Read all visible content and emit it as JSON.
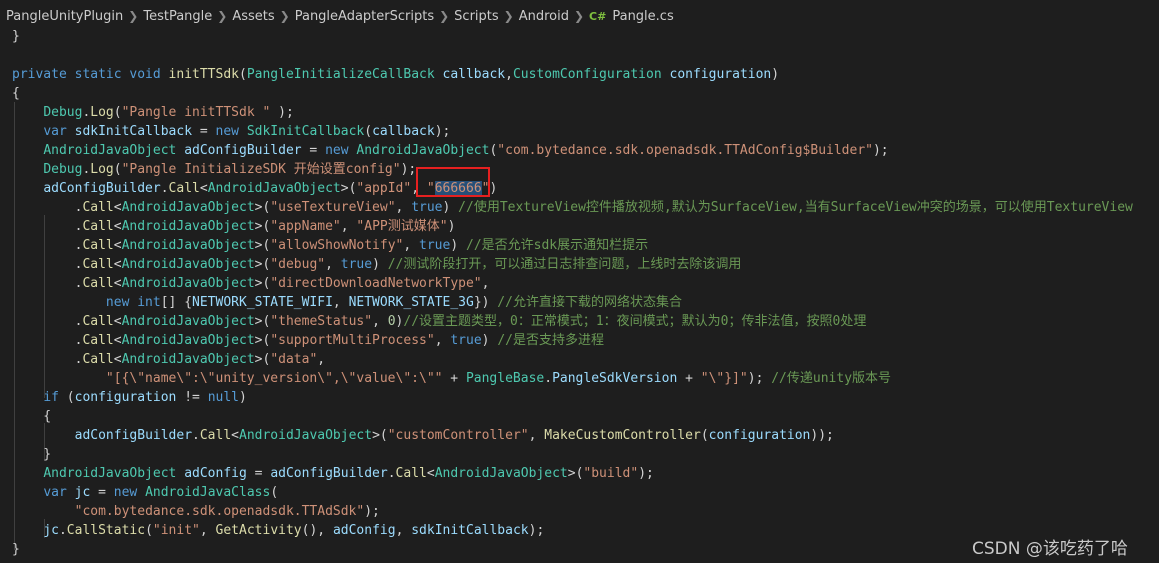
{
  "breadcrumb": {
    "items": [
      "PangleUnityPlugin",
      "TestPangle",
      "Assets",
      "PangleAdapterScripts",
      "Scripts",
      "Android"
    ],
    "file_lang_icon": "C#",
    "file_name": "Pangle.cs"
  },
  "code_lines": [
    [
      [
        "p",
        "}"
      ]
    ],
    [],
    [
      [
        "k",
        "private static void "
      ],
      [
        "f",
        "initTTSdk"
      ],
      [
        "p",
        "("
      ],
      [
        "t",
        "PangleInitializeCallBack"
      ],
      [
        "p",
        " "
      ],
      [
        "v",
        "callback"
      ],
      [
        "p",
        ","
      ],
      [
        "t",
        "CustomConfiguration"
      ],
      [
        "p",
        " "
      ],
      [
        "v",
        "configuration"
      ],
      [
        "p",
        ")"
      ]
    ],
    [
      [
        "p",
        "{"
      ]
    ],
    [
      [
        "p",
        "    "
      ],
      [
        "t",
        "Debug"
      ],
      [
        "p",
        "."
      ],
      [
        "f",
        "Log"
      ],
      [
        "p",
        "("
      ],
      [
        "s",
        "\"Pangle initTTSdk \""
      ],
      [
        "p",
        " );"
      ]
    ],
    [
      [
        "p",
        "    "
      ],
      [
        "k",
        "var "
      ],
      [
        "v",
        "sdkInitCallback"
      ],
      [
        "p",
        " = "
      ],
      [
        "k",
        "new "
      ],
      [
        "t",
        "SdkInitCallback"
      ],
      [
        "p",
        "("
      ],
      [
        "v",
        "callback"
      ],
      [
        "p",
        ");"
      ]
    ],
    [
      [
        "p",
        "    "
      ],
      [
        "t",
        "AndroidJavaObject"
      ],
      [
        "p",
        " "
      ],
      [
        "v",
        "adConfigBuilder"
      ],
      [
        "p",
        " = "
      ],
      [
        "k",
        "new "
      ],
      [
        "t",
        "AndroidJavaObject"
      ],
      [
        "p",
        "("
      ],
      [
        "s",
        "\"com.bytedance.sdk.openadsdk.TTAdConfig$Builder\""
      ],
      [
        "p",
        ");"
      ]
    ],
    [
      [
        "p",
        "    "
      ],
      [
        "t",
        "Debug"
      ],
      [
        "p",
        "."
      ],
      [
        "f",
        "Log"
      ],
      [
        "p",
        "("
      ],
      [
        "s",
        "\"Pangle InitializeSDK 开始设置config\""
      ],
      [
        "p",
        ");"
      ]
    ],
    [
      [
        "p",
        "    "
      ],
      [
        "v",
        "adConfigBuilder"
      ],
      [
        "p",
        "."
      ],
      [
        "f",
        "Call"
      ],
      [
        "p",
        "<"
      ],
      [
        "t",
        "AndroidJavaObject"
      ],
      [
        "p",
        ">("
      ],
      [
        "s",
        "\"appId\""
      ],
      [
        "p",
        ", "
      ],
      [
        "s",
        "\""
      ],
      [
        "sel",
        "666666"
      ],
      [
        "s",
        "\""
      ],
      [
        "p",
        ")"
      ]
    ],
    [
      [
        "p",
        "        ."
      ],
      [
        "f",
        "Call"
      ],
      [
        "p",
        "<"
      ],
      [
        "t",
        "AndroidJavaObject"
      ],
      [
        "p",
        ">("
      ],
      [
        "s",
        "\"useTextureView\""
      ],
      [
        "p",
        ", "
      ],
      [
        "k",
        "true"
      ],
      [
        "p",
        ") "
      ],
      [
        "c",
        "//使用TextureView控件播放视频,默认为SurfaceView,当有SurfaceView冲突的场景，可以使用TextureView"
      ]
    ],
    [
      [
        "p",
        "        ."
      ],
      [
        "f",
        "Call"
      ],
      [
        "p",
        "<"
      ],
      [
        "t",
        "AndroidJavaObject"
      ],
      [
        "p",
        ">("
      ],
      [
        "s",
        "\"appName\""
      ],
      [
        "p",
        ", "
      ],
      [
        "s",
        "\"APP测试媒体\""
      ],
      [
        "p",
        ")"
      ]
    ],
    [
      [
        "p",
        "        ."
      ],
      [
        "f",
        "Call"
      ],
      [
        "p",
        "<"
      ],
      [
        "t",
        "AndroidJavaObject"
      ],
      [
        "p",
        ">("
      ],
      [
        "s",
        "\"allowShowNotify\""
      ],
      [
        "p",
        ", "
      ],
      [
        "k",
        "true"
      ],
      [
        "p",
        ") "
      ],
      [
        "c",
        "//是否允许sdk展示通知栏提示"
      ]
    ],
    [
      [
        "p",
        "        ."
      ],
      [
        "f",
        "Call"
      ],
      [
        "p",
        "<"
      ],
      [
        "t",
        "AndroidJavaObject"
      ],
      [
        "p",
        ">("
      ],
      [
        "s",
        "\"debug\""
      ],
      [
        "p",
        ", "
      ],
      [
        "k",
        "true"
      ],
      [
        "p",
        ") "
      ],
      [
        "c",
        "//测试阶段打开，可以通过日志排查问题，上线时去除该调用"
      ]
    ],
    [
      [
        "p",
        "        ."
      ],
      [
        "f",
        "Call"
      ],
      [
        "p",
        "<"
      ],
      [
        "t",
        "AndroidJavaObject"
      ],
      [
        "p",
        ">("
      ],
      [
        "s",
        "\"directDownloadNetworkType\""
      ],
      [
        "p",
        ","
      ]
    ],
    [
      [
        "p",
        "            "
      ],
      [
        "k",
        "new "
      ],
      [
        "k",
        "int"
      ],
      [
        "p",
        "[] {"
      ],
      [
        "v",
        "NETWORK_STATE_WIFI"
      ],
      [
        "p",
        ", "
      ],
      [
        "v",
        "NETWORK_STATE_3G"
      ],
      [
        "p",
        "}) "
      ],
      [
        "c",
        "//允许直接下载的网络状态集合"
      ]
    ],
    [
      [
        "p",
        "        ."
      ],
      [
        "f",
        "Call"
      ],
      [
        "p",
        "<"
      ],
      [
        "t",
        "AndroidJavaObject"
      ],
      [
        "p",
        ">("
      ],
      [
        "s",
        "\"themeStatus\""
      ],
      [
        "p",
        ", "
      ],
      [
        "n",
        "0"
      ],
      [
        "p",
        ")"
      ],
      [
        "c",
        "//设置主题类型，0：正常模式；1：夜间模式；默认为0；传非法值，按照0处理"
      ]
    ],
    [
      [
        "p",
        "        ."
      ],
      [
        "f",
        "Call"
      ],
      [
        "p",
        "<"
      ],
      [
        "t",
        "AndroidJavaObject"
      ],
      [
        "p",
        ">("
      ],
      [
        "s",
        "\"supportMultiProcess\""
      ],
      [
        "p",
        ", "
      ],
      [
        "k",
        "true"
      ],
      [
        "p",
        ") "
      ],
      [
        "c",
        "//是否支持多进程"
      ]
    ],
    [
      [
        "p",
        "        ."
      ],
      [
        "f",
        "Call"
      ],
      [
        "p",
        "<"
      ],
      [
        "t",
        "AndroidJavaObject"
      ],
      [
        "p",
        ">("
      ],
      [
        "s",
        "\"data\""
      ],
      [
        "p",
        ","
      ]
    ],
    [
      [
        "p",
        "            "
      ],
      [
        "s",
        "\"[{\\\"name\\\":\\\"unity_version\\\",\\\"value\\\":\\\"\""
      ],
      [
        "p",
        " + "
      ],
      [
        "t",
        "PangleBase"
      ],
      [
        "p",
        "."
      ],
      [
        "v",
        "PangleSdkVersion"
      ],
      [
        "p",
        " + "
      ],
      [
        "s",
        "\"\\\"}]\""
      ],
      [
        "p",
        "); "
      ],
      [
        "c",
        "//传递unity版本号"
      ]
    ],
    [
      [
        "p",
        "    "
      ],
      [
        "k",
        "if"
      ],
      [
        "p",
        " ("
      ],
      [
        "v",
        "configuration"
      ],
      [
        "p",
        " != "
      ],
      [
        "k",
        "null"
      ],
      [
        "p",
        ")"
      ]
    ],
    [
      [
        "p",
        "    {"
      ]
    ],
    [
      [
        "p",
        "        "
      ],
      [
        "v",
        "adConfigBuilder"
      ],
      [
        "p",
        "."
      ],
      [
        "f",
        "Call"
      ],
      [
        "p",
        "<"
      ],
      [
        "t",
        "AndroidJavaObject"
      ],
      [
        "p",
        ">("
      ],
      [
        "s",
        "\"customController\""
      ],
      [
        "p",
        ", "
      ],
      [
        "f",
        "MakeCustomController"
      ],
      [
        "p",
        "("
      ],
      [
        "v",
        "configuration"
      ],
      [
        "p",
        "));"
      ]
    ],
    [
      [
        "p",
        "    }"
      ]
    ],
    [
      [
        "p",
        "    "
      ],
      [
        "t",
        "AndroidJavaObject"
      ],
      [
        "p",
        " "
      ],
      [
        "v",
        "adConfig"
      ],
      [
        "p",
        " = "
      ],
      [
        "v",
        "adConfigBuilder"
      ],
      [
        "p",
        "."
      ],
      [
        "f",
        "Call"
      ],
      [
        "p",
        "<"
      ],
      [
        "t",
        "AndroidJavaObject"
      ],
      [
        "p",
        ">("
      ],
      [
        "s",
        "\"build\""
      ],
      [
        "p",
        ");"
      ]
    ],
    [
      [
        "p",
        "    "
      ],
      [
        "k",
        "var "
      ],
      [
        "v",
        "jc"
      ],
      [
        "p",
        " = "
      ],
      [
        "k",
        "new "
      ],
      [
        "t",
        "AndroidJavaClass"
      ],
      [
        "p",
        "("
      ]
    ],
    [
      [
        "p",
        "        "
      ],
      [
        "s",
        "\"com.bytedance.sdk.openadsdk.TTAdSdk\""
      ],
      [
        "p",
        ");"
      ]
    ],
    [
      [
        "p",
        "    "
      ],
      [
        "v",
        "jc"
      ],
      [
        "p",
        "."
      ],
      [
        "f",
        "CallStatic"
      ],
      [
        "p",
        "("
      ],
      [
        "s",
        "\"init\""
      ],
      [
        "p",
        ", "
      ],
      [
        "f",
        "GetActivity"
      ],
      [
        "p",
        "(), "
      ],
      [
        "v",
        "adConfig"
      ],
      [
        "p",
        ", "
      ],
      [
        "v",
        "sdkInitCallback"
      ],
      [
        "p",
        ");"
      ]
    ],
    [
      [
        "p",
        "}"
      ]
    ]
  ],
  "watermark": "CSDN @该吃药了哈",
  "colors": {
    "background": "#1e1e1e",
    "keyword": "#569cd6",
    "type": "#4ec9b0",
    "function": "#dcdcaa",
    "string": "#ce9178",
    "variable": "#9cdcfe",
    "comment": "#6a9955",
    "highlight_box": "#e62020"
  }
}
